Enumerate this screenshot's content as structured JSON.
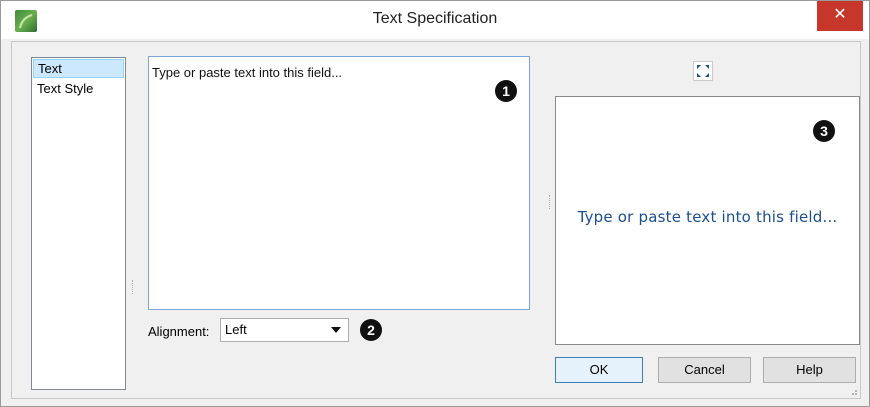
{
  "window": {
    "title": "Text Specification",
    "close_icon": "close-icon"
  },
  "nav": {
    "items": [
      {
        "label": "Text",
        "selected": true
      },
      {
        "label": "Text Style",
        "selected": false
      }
    ]
  },
  "text_field": {
    "value": "Type or paste text into this field..."
  },
  "alignment": {
    "label": "Alignment:",
    "value": "Left"
  },
  "preview": {
    "text": "Type or paste text into this field...",
    "text_color": "#1b4f8f"
  },
  "markers": [
    "1",
    "2",
    "3"
  ],
  "buttons": {
    "ok": "OK",
    "cancel": "Cancel",
    "help": "Help"
  },
  "colors": {
    "close_button": "#c7362b",
    "field_focus_border": "#7aa7d8",
    "selected_item": "#cce8ff"
  }
}
